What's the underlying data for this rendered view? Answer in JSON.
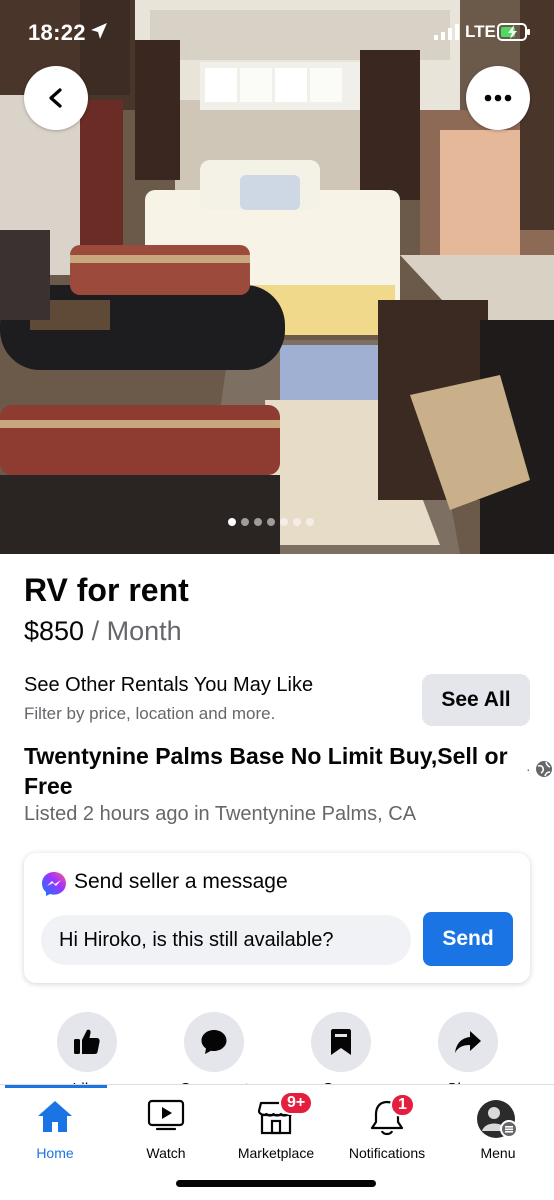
{
  "status_bar": {
    "time": "18:22",
    "network": "LTE",
    "icons": [
      "location-arrow-icon",
      "signal-icon",
      "battery-charging-icon"
    ]
  },
  "photo": {
    "icons": {
      "back": "chevron-left-icon",
      "more": "ellipsis-icon"
    },
    "carousel": {
      "total": 7,
      "active_index": 0
    }
  },
  "listing": {
    "title": "RV for rent",
    "price": "$850",
    "price_period": " / Month",
    "headline": "Twentynine Palms Base No Limit Buy,Sell or Free",
    "separator": "·",
    "listed": "Listed 2 hours ago in Twentynine Palms, CA"
  },
  "other_rentals": {
    "title": "See Other Rentals You May Like",
    "subtitle": "Filter by price, location and more.",
    "button": "See All"
  },
  "message": {
    "title": "Send seller a message",
    "input_value": "Hi Hiroko, is this still available?",
    "send_button": "Send"
  },
  "actions": [
    {
      "label": "Like",
      "icon": "thumbs-up-icon"
    },
    {
      "label": "Comment",
      "icon": "comment-icon"
    },
    {
      "label": "Save",
      "icon": "bookmark-icon"
    },
    {
      "label": "Share",
      "icon": "share-arrow-icon"
    }
  ],
  "tabbar": {
    "tabs": [
      {
        "label": "Home",
        "icon": "home-icon",
        "active": true
      },
      {
        "label": "Watch",
        "icon": "watch-video-icon"
      },
      {
        "label": "Marketplace",
        "icon": "marketplace-shop-icon",
        "badge": "9+"
      },
      {
        "label": "Notifications",
        "icon": "bell-icon",
        "badge": "1"
      },
      {
        "label": "Menu",
        "icon": "profile-avatar-icon"
      }
    ]
  },
  "colors": {
    "accent": "#1b74e4",
    "badge": "#e41e3f",
    "secondary_text": "#65676b",
    "button_gray": "#e4e6eb"
  }
}
